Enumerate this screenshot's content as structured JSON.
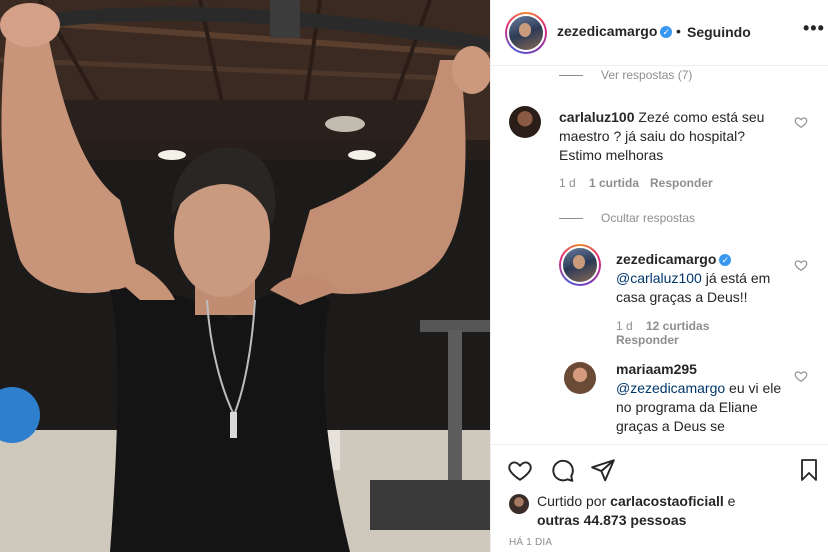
{
  "post": {
    "author": "zezedicamargo",
    "separator": "•",
    "follow_label": "Seguindo",
    "more_label": "•••"
  },
  "thread": {
    "view_replies": "Ver respostas (7)",
    "hide_replies": "Ocultar respostas"
  },
  "comments": [
    {
      "username": "carlaluz100",
      "text": "Zezé como está seu maestro ? já saiu do hospital? Estimo melhoras",
      "age": "1 d",
      "likes": "1 curtida",
      "reply_label": "Responder"
    },
    {
      "username": "zezedicamargo",
      "mention": "@carlaluz100",
      "text": " já está em casa graças a Deus!!",
      "age": "1 d",
      "likes": "12 curtidas",
      "reply_label": "Responder"
    },
    {
      "username": "mariaam295",
      "mention": "@zezedicamargo",
      "text": " eu vi ele no programa da Eliane graças a Deus se"
    }
  ],
  "likes": {
    "prefix": "Curtido por",
    "user": "carlacostaoficiall",
    "conj": "e",
    "others": "outras 44.873 pessoas"
  },
  "timestamp": "HÁ 1 DIA",
  "icons": [
    "heart-icon",
    "comment-icon",
    "share-icon",
    "bookmark-icon",
    "verified-badge-icon",
    "more-options-icon"
  ],
  "colors": {
    "verified": "#3897f0",
    "mention": "#00376b",
    "muted": "#8e8e8e",
    "text": "#262626"
  }
}
